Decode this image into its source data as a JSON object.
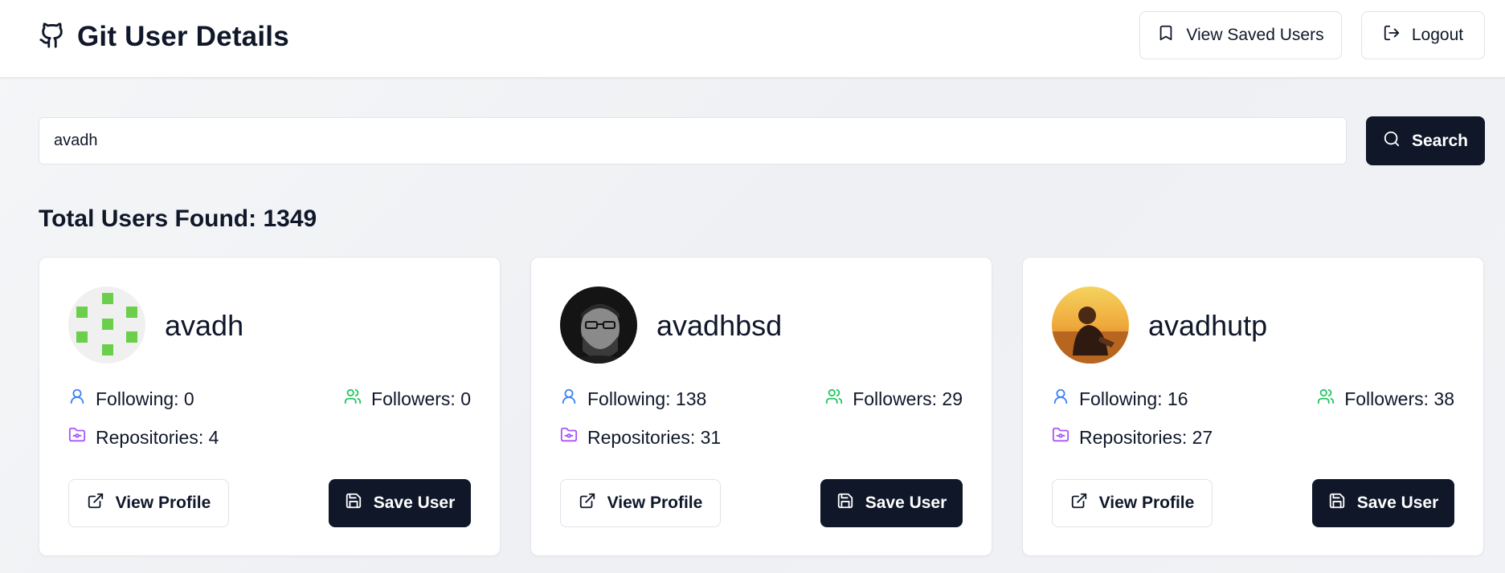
{
  "app": {
    "title": "Git User Details",
    "logo_icon": "github-icon"
  },
  "header": {
    "saved_label": "View Saved Users",
    "saved_icon": "bookmark-icon",
    "logout_label": "Logout",
    "logout_icon": "logout-icon"
  },
  "search": {
    "value": "avadh",
    "placeholder": "",
    "button_label": "Search",
    "button_icon": "search-icon"
  },
  "results": {
    "total_label": "Total Users Found: 1349"
  },
  "users": [
    {
      "username": "avadh",
      "avatar": "identicon-green-avatar",
      "following": "Following: 0",
      "followers": "Followers: 0",
      "repositories": "Repositories: 4",
      "view_label": "View Profile",
      "save_label": "Save User"
    },
    {
      "username": "avadhbsd",
      "avatar": "photo-avatar-man-glasses",
      "following": "Following: 138",
      "followers": "Followers: 29",
      "repositories": "Repositories: 31",
      "view_label": "View Profile",
      "save_label": "Save User"
    },
    {
      "username": "avadhutp",
      "avatar": "photo-avatar-sunset",
      "following": "Following: 16",
      "followers": "Followers: 38",
      "repositories": "Repositories: 27",
      "view_label": "View Profile",
      "save_label": "Save User"
    }
  ],
  "colors": {
    "primary": "#0f1729",
    "following_icon": "#3b82f6",
    "followers_icon": "#22c55e",
    "repositories_icon": "#a855f7",
    "identicon_green": "#6bcf4b"
  }
}
